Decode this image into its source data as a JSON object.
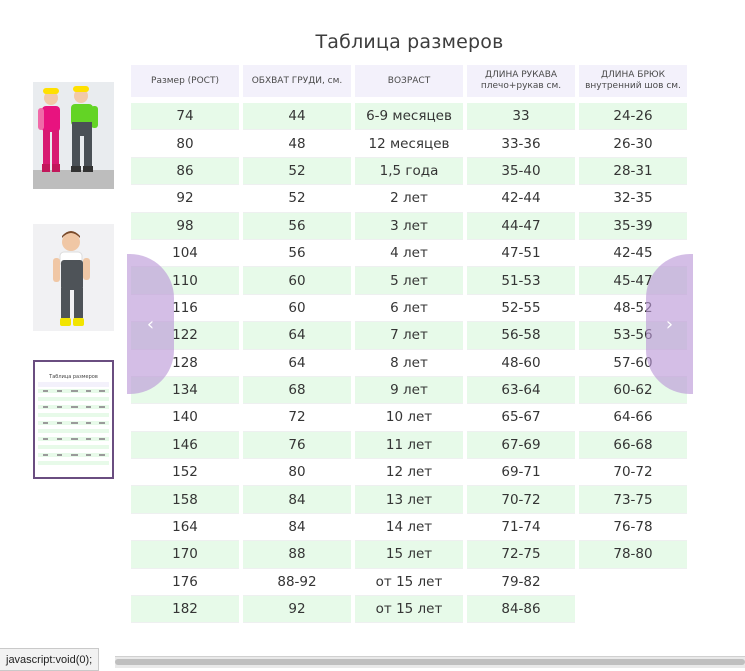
{
  "title": "Таблица размеров",
  "headers": [
    [
      "Размер (РОСТ)"
    ],
    [
      "ОБХВАТ ГРУДИ, см."
    ],
    [
      "ВОЗРАСТ"
    ],
    [
      "ДЛИНА РУКАВА",
      "плечо+рукав см."
    ],
    [
      "ДЛИНА БРЮК",
      "внутренний шов см."
    ]
  ],
  "rows": [
    [
      "74",
      "44",
      "6-9 месяцев",
      "33",
      "24-26"
    ],
    [
      "80",
      "48",
      "12 месяцев",
      "33-36",
      "26-30"
    ],
    [
      "86",
      "52",
      "1,5 года",
      "35-40",
      "28-31"
    ],
    [
      "92",
      "52",
      "2 лет",
      "42-44",
      "32-35"
    ],
    [
      "98",
      "56",
      "3 лет",
      "44-47",
      "35-39"
    ],
    [
      "104",
      "56",
      "4 лет",
      "47-51",
      "42-45"
    ],
    [
      "110",
      "60",
      "5 лет",
      "51-53",
      "45-47"
    ],
    [
      "116",
      "60",
      "6 лет",
      "52-55",
      "48-52"
    ],
    [
      "122",
      "64",
      "7 лет",
      "56-58",
      "53-56"
    ],
    [
      "128",
      "64",
      "8 лет",
      "48-60",
      "57-60"
    ],
    [
      "134",
      "68",
      "9 лет",
      "63-64",
      "60-62"
    ],
    [
      "140",
      "72",
      "10 лет",
      "65-67",
      "64-66"
    ],
    [
      "146",
      "76",
      "11 лет",
      "67-69",
      "66-68"
    ],
    [
      "152",
      "80",
      "12 лет",
      "69-71",
      "70-72"
    ],
    [
      "158",
      "84",
      "13 лет",
      "70-72",
      "73-75"
    ],
    [
      "164",
      "84",
      "14 лет",
      "71-74",
      "76-78"
    ],
    [
      "170",
      "88",
      "15 лет",
      "72-75",
      "78-80"
    ],
    [
      "176",
      "88-92",
      "от 15 лет",
      "79-82",
      ""
    ],
    [
      "182",
      "92",
      "от 15 лет",
      "84-86",
      ""
    ]
  ],
  "thumb_mini_title": "Таблица размеров",
  "nav": {
    "prev_icon": "chevron-left-icon",
    "next_icon": "chevron-right-icon",
    "prev_glyph": "‹",
    "next_glyph": "›"
  },
  "status_bar": "javascript:void(0);",
  "colors": {
    "row_green": "#e7fae9",
    "header_bg": "#f3f1fb",
    "arrow": "#b996d7",
    "thumb_border": "#6a4d80"
  }
}
